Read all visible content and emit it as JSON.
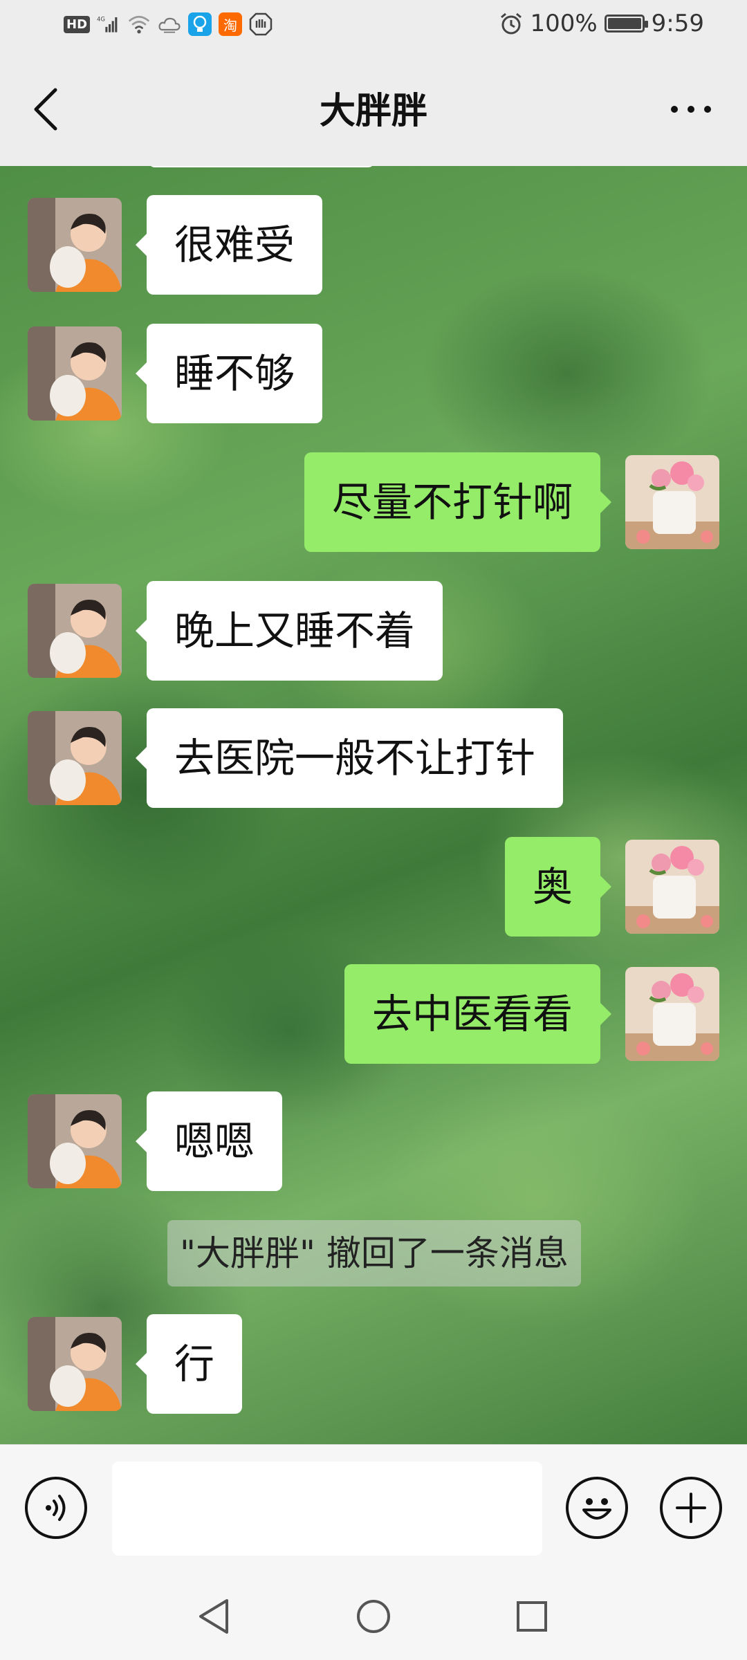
{
  "status_bar": {
    "left_icons": [
      "hd-icon",
      "signal-4g-icon",
      "wifi-icon",
      "cloud-icon",
      "lightbulb-app-icon",
      "taobao-app-icon",
      "shield-app-icon"
    ],
    "hd_label": "HD",
    "network_label": "4G",
    "taobao_label": "淘",
    "battery_percent": "100%",
    "battery_level": 1.0,
    "time": "9:59"
  },
  "header": {
    "title": "大胖胖"
  },
  "messages": [
    {
      "from": "them",
      "text": "很难受"
    },
    {
      "from": "them",
      "text": "睡不够"
    },
    {
      "from": "me",
      "text": "尽量不打针啊"
    },
    {
      "from": "them",
      "text": "晚上又睡不着"
    },
    {
      "from": "them",
      "text": "去医院一般不让打针"
    },
    {
      "from": "me",
      "text": "奥"
    },
    {
      "from": "me",
      "text": "去中医看看"
    },
    {
      "from": "them",
      "text": "嗯嗯"
    },
    {
      "from": "system",
      "text": "\"大胖胖\" 撤回了一条消息"
    },
    {
      "from": "them",
      "text": "行"
    }
  ],
  "input_bar": {
    "voice_icon": "voice-icon",
    "input_value": "",
    "emoji_icon": "smile-emoji-icon",
    "plus_icon": "plus-icon"
  },
  "nav_bar": {
    "icons": [
      "back-triangle-icon",
      "home-circle-icon",
      "recents-square-icon"
    ]
  },
  "colors": {
    "incoming_bubble": "#ffffff",
    "outgoing_bubble": "#95ec69",
    "bar_background": "#ededed"
  }
}
